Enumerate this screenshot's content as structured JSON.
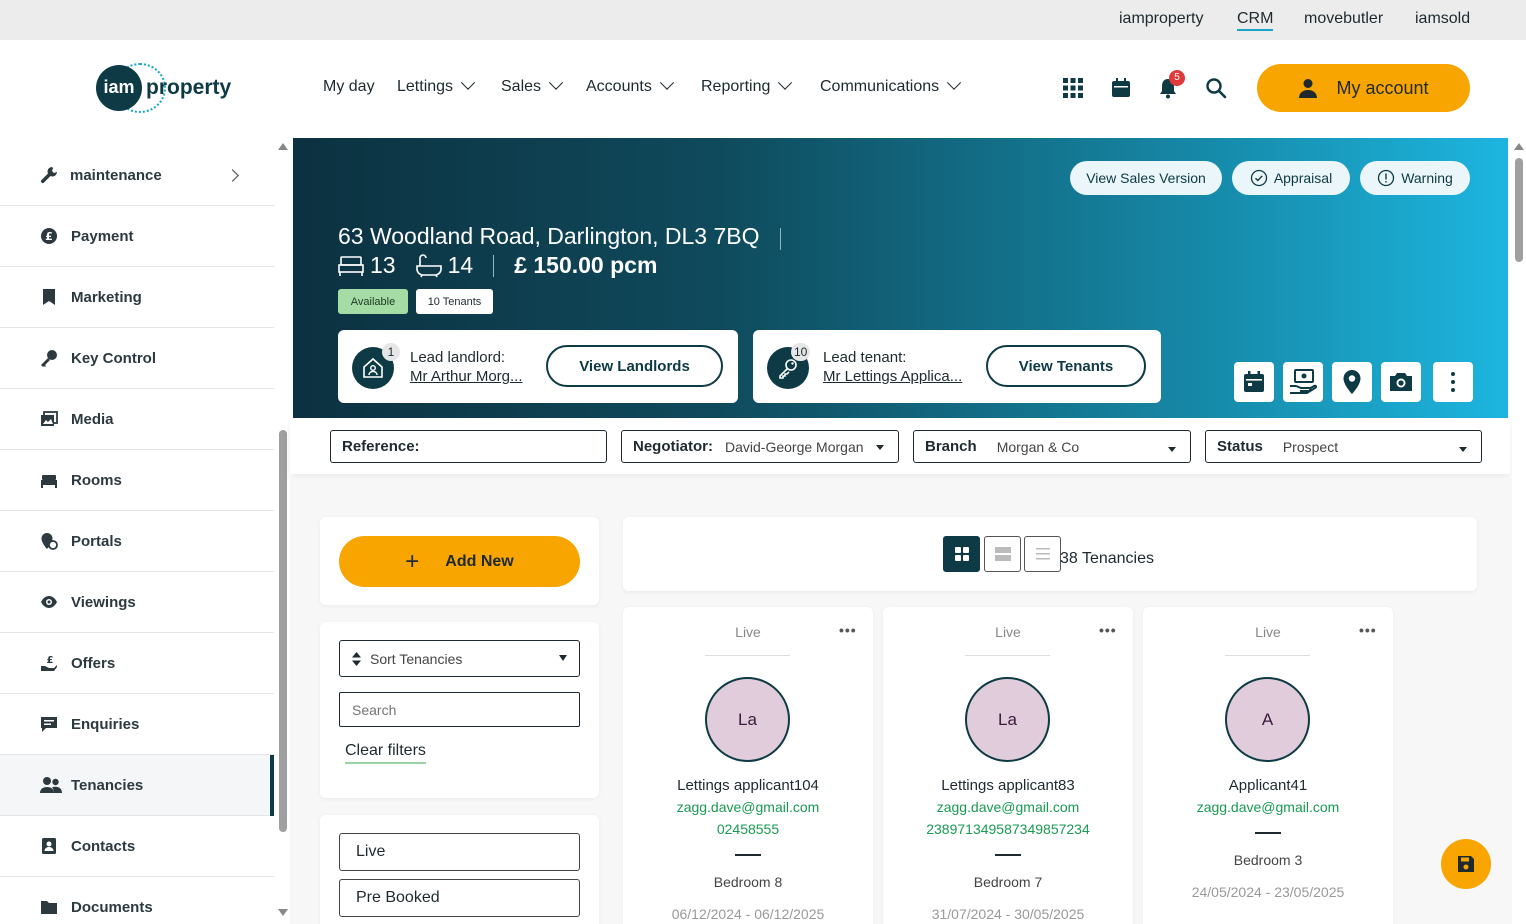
{
  "product_bar": {
    "links": [
      {
        "label": "iamproperty",
        "active": false
      },
      {
        "label": "CRM",
        "active": true
      },
      {
        "label": "movebutler",
        "active": false
      },
      {
        "label": "iamsold",
        "active": false
      }
    ]
  },
  "logo": {
    "mark": "iam",
    "word": "property"
  },
  "nav": {
    "my_day": "My day",
    "lettings": "Lettings",
    "sales": "Sales",
    "accounts": "Accounts",
    "reporting": "Reporting",
    "communications": "Communications"
  },
  "header_icons": [
    "apps-grid-icon",
    "calendar-icon",
    "bell-icon",
    "search-icon"
  ],
  "notifications_count": "5",
  "account_button": "My account",
  "sidebar": {
    "items": [
      {
        "label": "maintenance",
        "icon": "wrench-icon"
      },
      {
        "label": "Payment",
        "icon": "pound-icon"
      },
      {
        "label": "Marketing",
        "icon": "bookmark-icon"
      },
      {
        "label": "Key Control",
        "icon": "key-icon"
      },
      {
        "label": "Media",
        "icon": "media-icon"
      },
      {
        "label": "Rooms",
        "icon": "bed-icon"
      },
      {
        "label": "Portals",
        "icon": "portal-icon"
      },
      {
        "label": "Viewings",
        "icon": "eye-icon"
      },
      {
        "label": "Offers",
        "icon": "offer-icon"
      },
      {
        "label": "Enquiries",
        "icon": "chat-icon"
      },
      {
        "label": "Tenancies",
        "icon": "people-icon",
        "active": true
      },
      {
        "label": "Contacts",
        "icon": "contact-card-icon"
      },
      {
        "label": "Documents",
        "icon": "folder-icon"
      }
    ]
  },
  "property": {
    "address": "63 Woodland Road, Darlington, DL3 7BQ",
    "bedrooms": "13",
    "bathrooms": "14",
    "price": "£ 150.00 pcm",
    "availability": "Available",
    "tenants_tag": "10 Tenants",
    "actions": {
      "view_sales": "View Sales Version",
      "appraisal": "Appraisal",
      "warning": "Warning"
    },
    "lead_landlord": {
      "label": "Lead landlord:",
      "name": "Mr Arthur Morg...",
      "count": "1",
      "button": "View Landlords"
    },
    "lead_tenant": {
      "label": "Lead tenant:",
      "name": "Mr Lettings Applica...",
      "count": "10",
      "button": "View Tenants"
    },
    "quick_actions": [
      "calendar-icon",
      "money-hand-icon",
      "map-pin-icon",
      "camera-icon",
      "more-vertical-icon"
    ]
  },
  "filters": {
    "reference_label": "Reference:",
    "reference_value": "",
    "negotiator_label": "Negotiator:",
    "negotiator_value": "David-George Morgan",
    "branch_label": "Branch",
    "branch_value": "Morgan & Co",
    "status_label": "Status",
    "status_value": "Prospect"
  },
  "left_panel": {
    "add_new": "Add New",
    "sort_label": "Sort Tenancies",
    "search_placeholder": "Search",
    "clear_filters": "Clear filters",
    "status_options": [
      "Live",
      "Pre Booked"
    ]
  },
  "view_bar": {
    "count_label": "38 Tenancies",
    "active_view": "grid"
  },
  "tenancies": [
    {
      "status": "Live",
      "initials": "La",
      "name": "Lettings applicant104",
      "email": "zagg.dave@gmail.com",
      "phone": "02458555",
      "room": "Bedroom 8",
      "dates": "06/12/2024 - 06/12/2025"
    },
    {
      "status": "Live",
      "initials": "La",
      "name": "Lettings applicant83",
      "email": "zagg.dave@gmail.com",
      "phone": "238971349587349857234",
      "room": "Bedroom 7",
      "dates": "31/07/2024 - 30/05/2025"
    },
    {
      "status": "Live",
      "initials": "A",
      "name": "Applicant41",
      "email": "zagg.dave@gmail.com",
      "phone": "",
      "room": "Bedroom 3",
      "dates": "24/05/2024 - 23/05/2025"
    }
  ],
  "colors": {
    "accent": "#f8a500",
    "dark": "#0d3a44",
    "hero_end": "#1db5df",
    "available": "#a5dca6",
    "email": "#1a9a53"
  }
}
